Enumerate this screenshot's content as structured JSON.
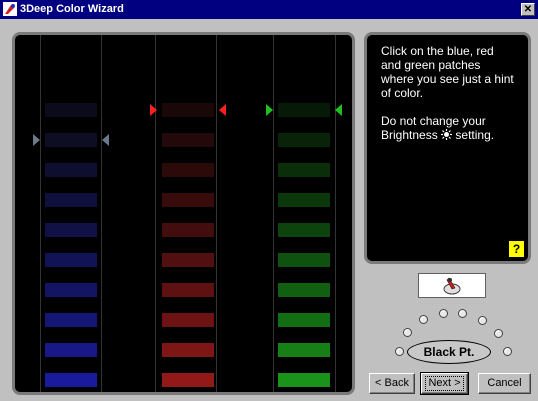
{
  "window": {
    "title": "3Deep Color Wizard",
    "close_glyph": "✕"
  },
  "instructions": {
    "lines": [
      "Click on the blue, red",
      "and green patches",
      "where you see just a hint",
      "of color.",
      "Do not change your",
      "Brightness",
      "setting."
    ]
  },
  "help": {
    "label": "?"
  },
  "control": {
    "black_point_label": "Black Pt."
  },
  "buttons": {
    "back": "< Back",
    "next": "Next >",
    "cancel": "Cancel"
  },
  "patches": {
    "blue": [
      "#0b0b1b",
      "#0d0d24",
      "#0e0e30",
      "#0f0f3b",
      "#111148",
      "#121256",
      "#141465",
      "#161676",
      "#181889",
      "#1a1a9c"
    ],
    "red": [
      "#1a0707",
      "#230909",
      "#2d0a0a",
      "#380b0b",
      "#440d0d",
      "#510f0f",
      "#5f1111",
      "#6e1313",
      "#7f1616",
      "#931919"
    ],
    "green": [
      "#071a07",
      "#092309",
      "#0a2d0a",
      "#0b380b",
      "#0d440d",
      "#0f510f",
      "#115f11",
      "#136e13",
      "#167f16",
      "#199319"
    ]
  },
  "markers": {
    "blue": {
      "color": "#6a7a8a",
      "row": 1
    },
    "red": {
      "color": "#ff2020",
      "row": 0
    },
    "green": {
      "color": "#20c020",
      "row": 0
    }
  },
  "icons": {
    "app": "3deep-logo-icon",
    "help": "help-icon",
    "brightness": "sun-icon"
  }
}
